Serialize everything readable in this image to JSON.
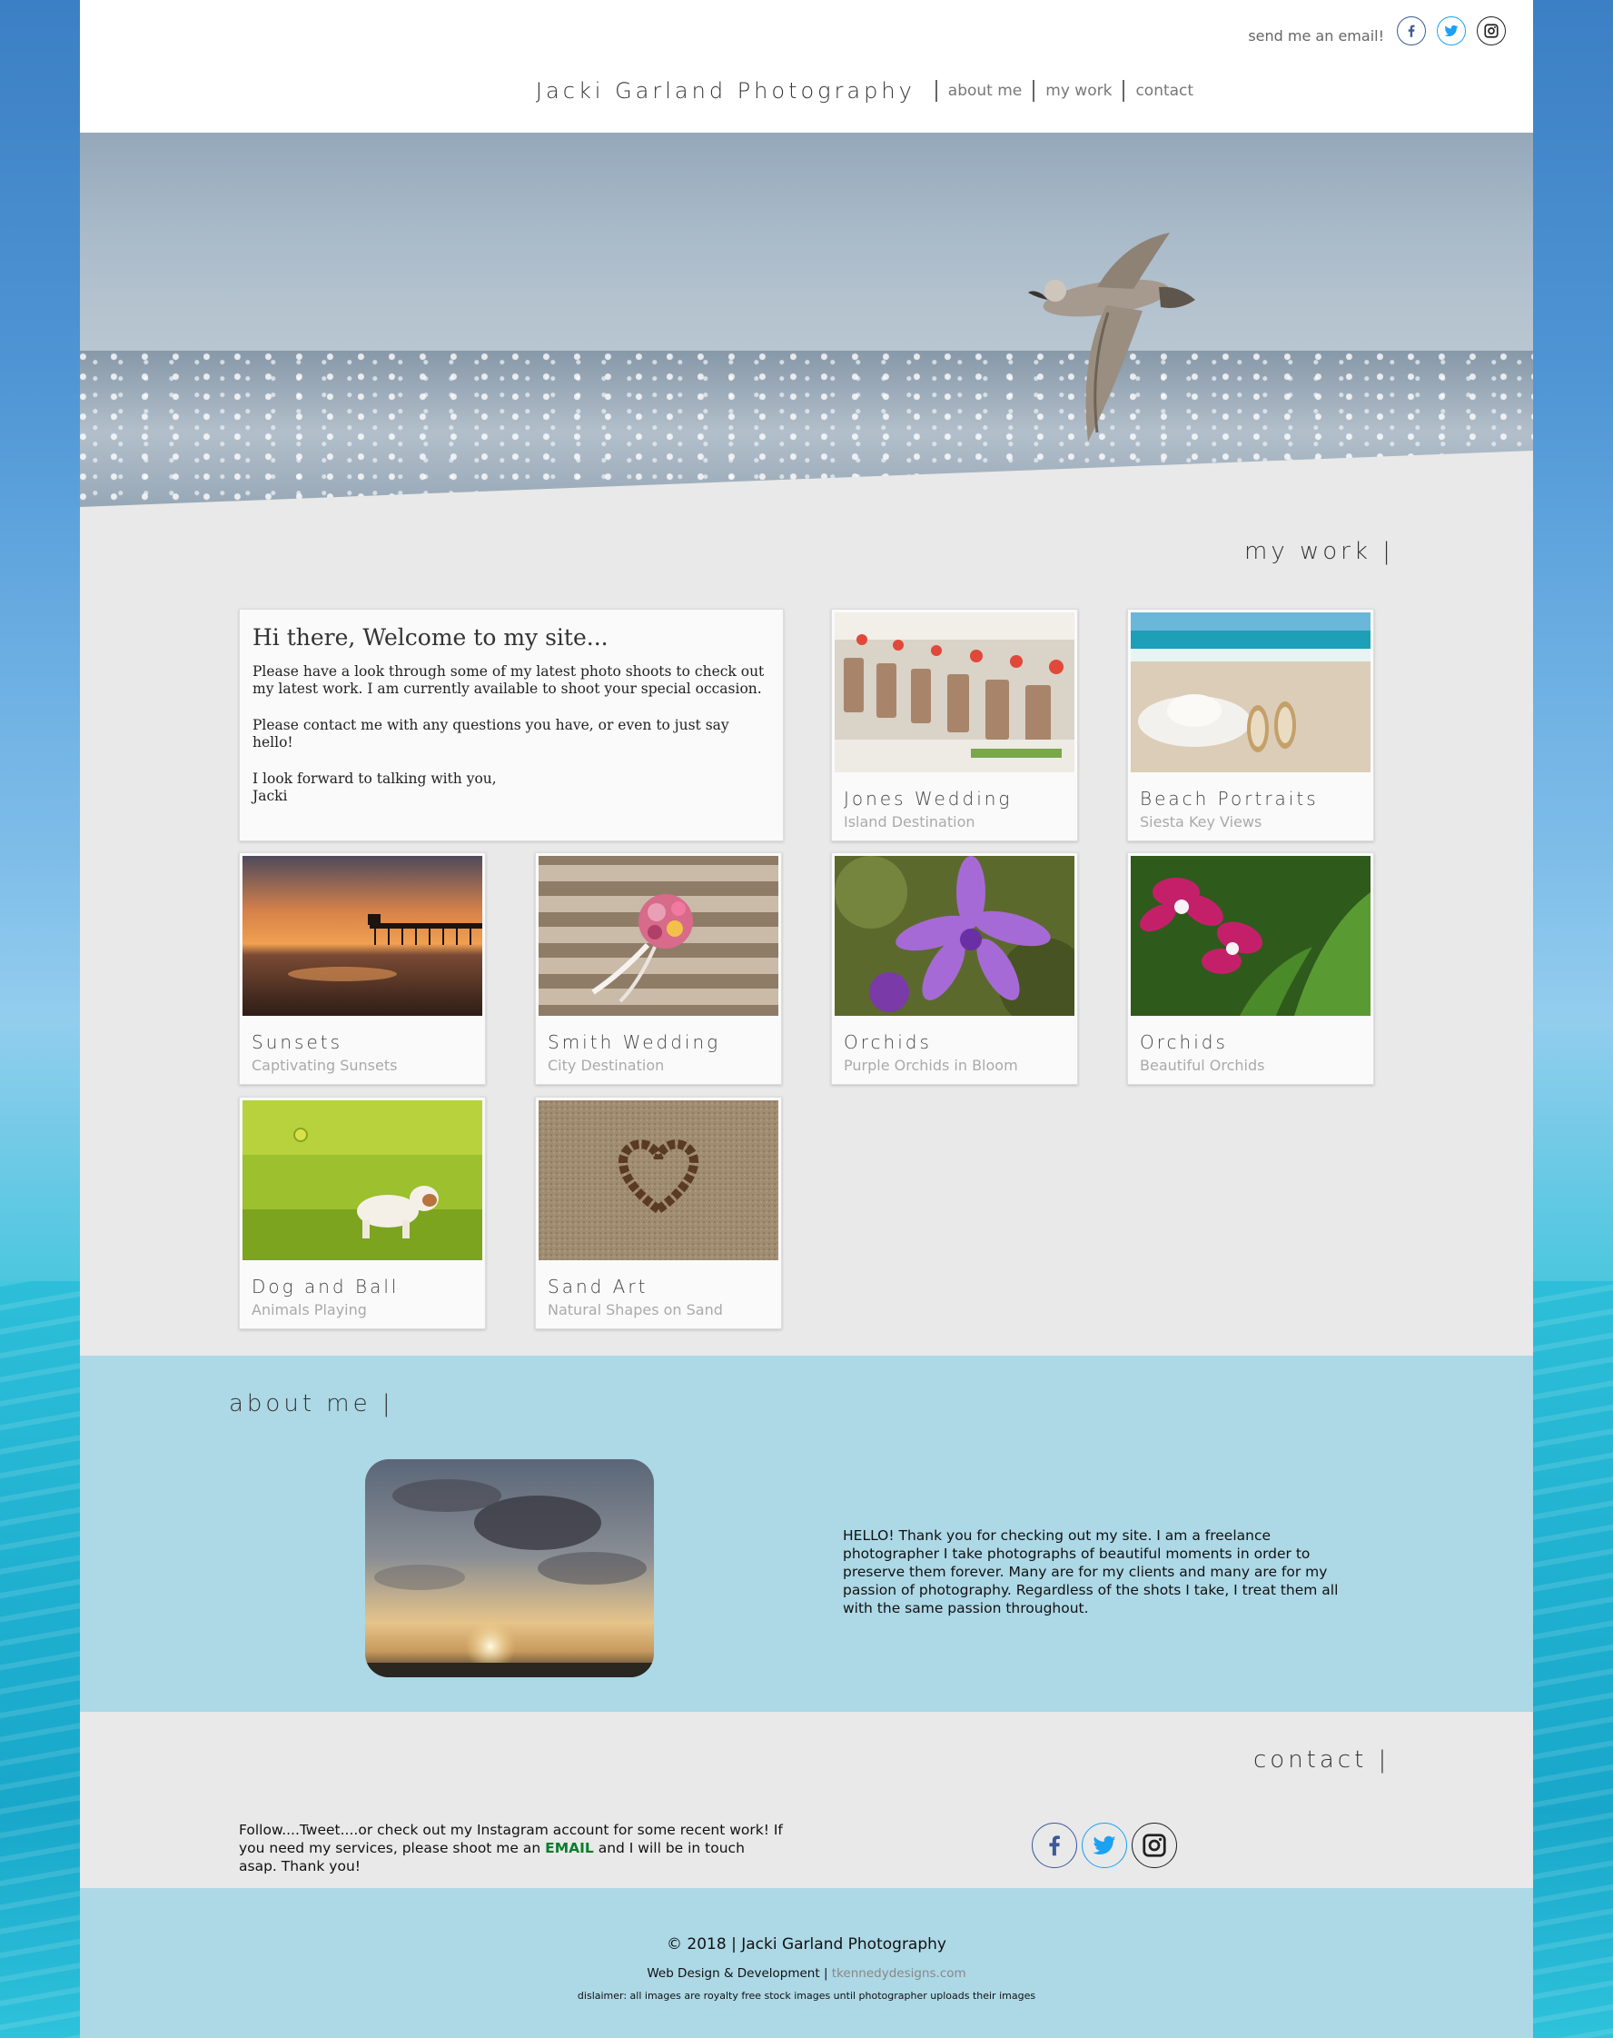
{
  "header": {
    "email_link": "send me an email!",
    "brand": "Jacki Garland Photography",
    "nav": [
      "about me",
      "my work",
      "contact"
    ]
  },
  "work": {
    "title": "my work |",
    "welcome": {
      "heading": "Hi there, Welcome to my site...",
      "p1": "Please have a look through some of my latest photo shoots to check out my latest work. I am currently available to shoot your special occasion.",
      "p2": "Please contact me with any questions you have, or even to just say hello!",
      "p3a": "I look forward to talking with you,",
      "p3b": "Jacki"
    },
    "cards": [
      {
        "title": "Jones Wedding",
        "subtitle": "Island Destination",
        "icon": "wedding-chairs-photo"
      },
      {
        "title": "Beach Portraits",
        "subtitle": "Siesta Key Views",
        "icon": "beach-hat-photo"
      },
      {
        "title": "Sunsets",
        "subtitle": "Captivating Sunsets",
        "icon": "pier-sunset-photo"
      },
      {
        "title": "Smith Wedding",
        "subtitle": "City Destination",
        "icon": "bouquet-steps-photo"
      },
      {
        "title": "Orchids",
        "subtitle": "Purple Orchids in Bloom",
        "icon": "purple-orchid-photo"
      },
      {
        "title": "Orchids",
        "subtitle": "Beautiful Orchids",
        "icon": "pink-orchid-photo"
      },
      {
        "title": "Dog and Ball",
        "subtitle": "Animals Playing",
        "icon": "dog-ball-photo"
      },
      {
        "title": "Sand Art",
        "subtitle": "Natural Shapes on Sand",
        "icon": "sand-heart-photo"
      }
    ]
  },
  "about": {
    "title": "about me |",
    "text": "HELLO! Thank you for checking out my site. I am a freelance photographer I take photographs of beautiful moments in order to preserve them forever. Many are for my clients and many are for my passion of photography. Regardless of the shots I take, I treat them all with the same passion throughout."
  },
  "contact": {
    "title": "contact |",
    "text_before": "Follow....Tweet....or check out my Instagram account for some recent work! If you need my services, please shoot me an ",
    "email_word": "EMAIL",
    "text_after": " and I will be in touch asap. Thank you!"
  },
  "footer": {
    "copyright": "© 2018 | Jacki Garland Photography",
    "credit": "Web Design & Development |",
    "credit_link": "tkennedydesigns.com",
    "disclaimer": "dislaimer: all images are royalty free stock images until photographer uploads their images"
  },
  "colors": {
    "accent_blue": "#add8e6",
    "email_green": "#0a7d2b",
    "facebook": "#3b5998",
    "twitter": "#1da1f2"
  }
}
